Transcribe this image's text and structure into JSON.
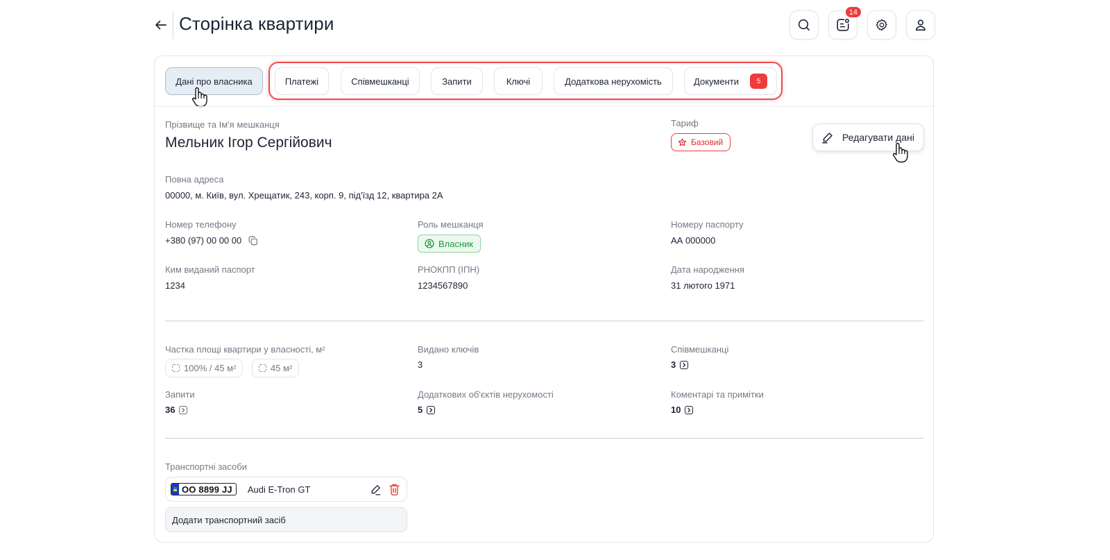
{
  "header": {
    "title": "Сторінка квартири",
    "notification_count": "14"
  },
  "tabs": [
    {
      "label": "Дані про власника",
      "active": true
    },
    {
      "label": "Платежі"
    },
    {
      "label": "Співмешканці"
    },
    {
      "label": "Запити"
    },
    {
      "label": "Ключі"
    },
    {
      "label": "Додаткова нерухомість"
    },
    {
      "label": "Документи",
      "count": "5"
    }
  ],
  "owner": {
    "name_label": "Прізвище та Ім'я мешканця",
    "name": "Мельник Ігор Сергійович",
    "tariff_label": "Тариф",
    "tariff": "Базовий",
    "edit_button": "Редагувати дані",
    "address_label": "Повна адреса",
    "address": "00000, м. Київ, вул. Хрещатик, 243, корп. 9, під'їзд 12, квартира 2А",
    "phone_label": "Номер телефону",
    "phone": "+380 (97) 00 00 00",
    "role_label": "Роль мешканця",
    "role": "Власник",
    "passport_label": "Номеру паспорту",
    "passport": "АА 000000",
    "issued_by_label": "Ким виданий паспорт",
    "issued_by": "1234",
    "tax_id_label": "РНОКПП (ІПН)",
    "tax_id": "1234567890",
    "birth_label": "Дата народження",
    "birth": "31 лютого 1971"
  },
  "stats": {
    "share_label": "Частка площі квартири у власності, м²",
    "share_chips": [
      "100% / 45 м²",
      "45 м²"
    ],
    "keys_label": "Видано ключів",
    "keys": "3",
    "cohabitants_label": "Співмешканці",
    "cohabitants": "3",
    "requests_label": "Запити",
    "requests": "36",
    "additional_label": "Додаткових об'єктів нерухомості",
    "additional": "5",
    "comments_label": "Коментарі та примітки",
    "comments": "10"
  },
  "vehicles": {
    "label": "Транспортні засоби",
    "items": [
      {
        "plate": "OO 8899 JJ",
        "model": "Audi E-Tron GT"
      }
    ],
    "add_button": "Додати транспортний засіб"
  },
  "colors": {
    "accent_red": "#ef3b3b",
    "success_green": "#1f9a3f",
    "active_tab_bg": "#e6eef5",
    "text_primary": "#1c2333",
    "text_muted": "#737a86"
  },
  "icons": [
    "arrow-left-icon",
    "search-icon",
    "notification-icon",
    "gear-icon",
    "user-icon",
    "copy-icon",
    "user-circle-icon",
    "star-icon",
    "pencil-icon",
    "trash-icon",
    "chevron-right-icon",
    "dashed-square-icon",
    "pointer-hand-icon"
  ]
}
